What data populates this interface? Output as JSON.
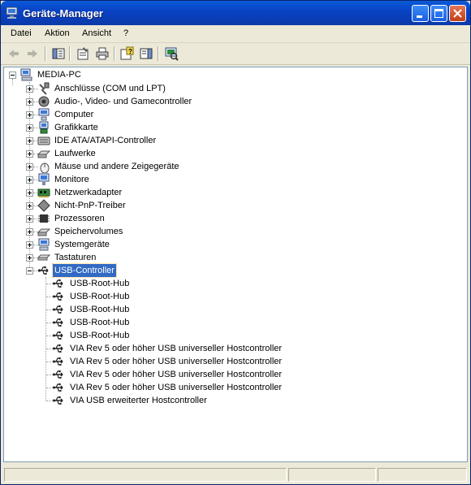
{
  "window": {
    "title": "Geräte-Manager",
    "title_icon": "computer-monitor-icon"
  },
  "menu": [
    "Datei",
    "Aktion",
    "Ansicht",
    "?"
  ],
  "toolbar": {
    "buttons": [
      "back-arrow-icon",
      "forward-arrow-icon",
      "show-hide-console-tree-icon",
      "properties-icon",
      "print-icon",
      "help-icon",
      "show-hide-action-pane-icon",
      "scan-hardware-icon"
    ]
  },
  "tree": {
    "root": "MEDIA-PC",
    "categories": [
      {
        "label": "Anschlüsse (COM und LPT)",
        "icon": "port-connector-icon"
      },
      {
        "label": "Audio-, Video- und Gamecontroller",
        "icon": "speaker-icon"
      },
      {
        "label": "Computer",
        "icon": "computer-icon"
      },
      {
        "label": "Grafikkarte",
        "icon": "display-adapter-icon"
      },
      {
        "label": "IDE ATA/ATAPI-Controller",
        "icon": "ide-controller-icon"
      },
      {
        "label": "Laufwerke",
        "icon": "disk-drive-icon"
      },
      {
        "label": "Mäuse und andere Zeigegeräte",
        "icon": "mouse-icon"
      },
      {
        "label": "Monitore",
        "icon": "monitor-icon"
      },
      {
        "label": "Netzwerkadapter",
        "icon": "network-card-icon"
      },
      {
        "label": "Nicht-PnP-Treiber",
        "icon": "non-pnp-driver-icon"
      },
      {
        "label": "Prozessoren",
        "icon": "processor-chip-icon"
      },
      {
        "label": "Speichervolumes",
        "icon": "storage-volume-icon"
      },
      {
        "label": "Systemgeräte",
        "icon": "system-device-icon"
      },
      {
        "label": "Tastaturen",
        "icon": "keyboard-icon"
      }
    ],
    "usb": {
      "label": "USB-Controller",
      "icon": "usb-icon",
      "children": [
        "USB-Root-Hub",
        "USB-Root-Hub",
        "USB-Root-Hub",
        "USB-Root-Hub",
        "USB-Root-Hub",
        "VIA Rev 5 oder höher USB universeller Hostcontroller",
        "VIA Rev 5 oder höher USB universeller Hostcontroller",
        "VIA Rev 5 oder höher USB universeller Hostcontroller",
        "VIA Rev 5 oder höher USB universeller Hostcontroller",
        "VIA USB erweiterter Hostcontroller"
      ]
    }
  },
  "colors": {
    "selection": "#316ac5",
    "titlebar": "#0a5ad8"
  }
}
